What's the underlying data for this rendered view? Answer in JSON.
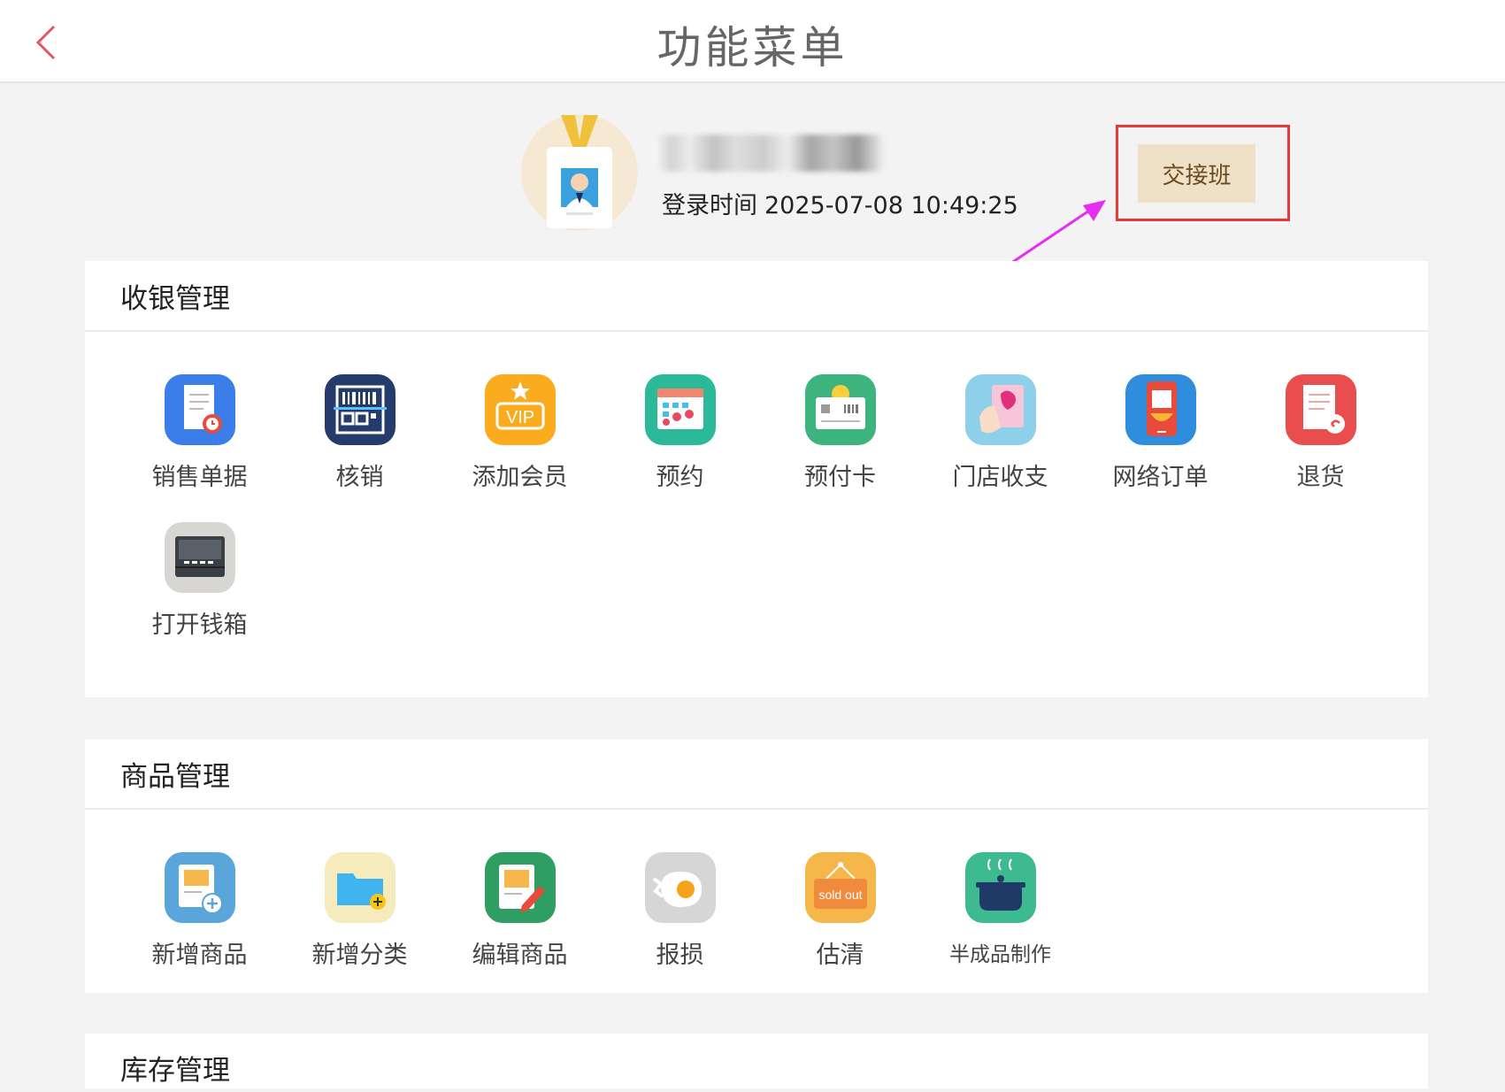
{
  "header": {
    "title": "功能菜单",
    "back_icon": "chevron-left-icon",
    "accent": "#e8555a"
  },
  "profile": {
    "login_label": "登录时间",
    "login_time": "2025-07-08 10:49:25",
    "handover_label": "交接班",
    "avatar_icon": "badge-avatar-icon"
  },
  "annotation": {
    "highlight_color": "#e53935",
    "arrow_color": "#e52ef0"
  },
  "sections": [
    {
      "title": "收银管理",
      "items": [
        {
          "label": "销售单据",
          "icon": "receipt-clock-icon"
        },
        {
          "label": "核销",
          "icon": "barcode-scan-icon"
        },
        {
          "label": "添加会员",
          "icon": "vip-icon"
        },
        {
          "label": "预约",
          "icon": "calendar-icon"
        },
        {
          "label": "预付卡",
          "icon": "prepaid-card-icon"
        },
        {
          "label": "门店收支",
          "icon": "cash-hand-icon"
        },
        {
          "label": "网络订单",
          "icon": "phone-order-icon"
        },
        {
          "label": "退货",
          "icon": "return-receipt-icon"
        },
        {
          "label": "打开钱箱",
          "icon": "cash-drawer-icon"
        }
      ]
    },
    {
      "title": "商品管理",
      "items": [
        {
          "label": "新增商品",
          "icon": "add-product-icon"
        },
        {
          "label": "新增分类",
          "icon": "add-folder-icon"
        },
        {
          "label": "编辑商品",
          "icon": "edit-product-icon"
        },
        {
          "label": "报损",
          "icon": "broken-egg-icon"
        },
        {
          "label": "估清",
          "icon": "sold-out-sign-icon",
          "sign_text": "sold out"
        },
        {
          "label": "半成品制作",
          "icon": "cooking-pot-icon"
        }
      ]
    },
    {
      "title": "库存管理"
    }
  ]
}
